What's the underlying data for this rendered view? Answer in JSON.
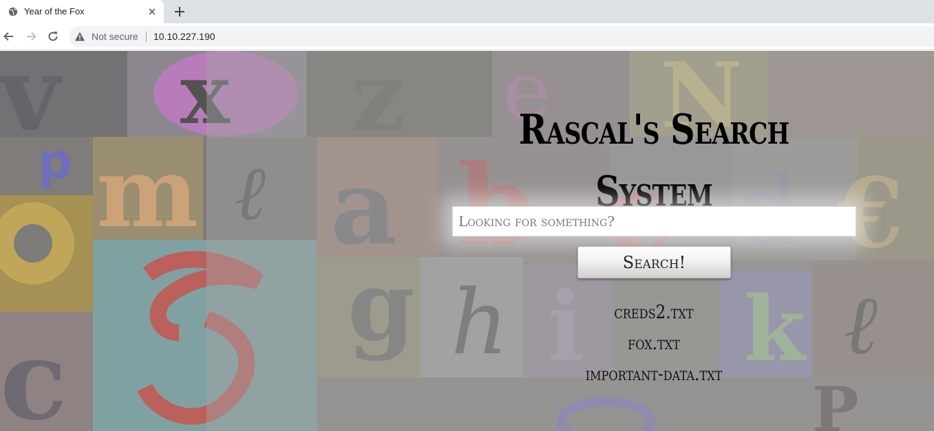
{
  "browser": {
    "tab_title": "Year of the Fox",
    "security_label": "Not secure",
    "url": "10.10.227.190"
  },
  "page": {
    "title": "Rascal's Search System",
    "search": {
      "placeholder": "Looking for something?",
      "value": ""
    },
    "search_button_label": "Search!",
    "results": [
      "creds2.txt",
      "fox.txt",
      "important-data.txt"
    ]
  },
  "icons": {
    "tab_favicon": "globe-icon",
    "tab_close": "close-icon",
    "new_tab": "plus-icon",
    "back": "arrow-left-icon",
    "forward": "arrow-right-icon",
    "reload": "reload-icon",
    "security": "warning-icon"
  },
  "colors": {
    "title": "#000000",
    "tabstrip": "#dee1e6",
    "omnibox": "#f1f3f4"
  }
}
